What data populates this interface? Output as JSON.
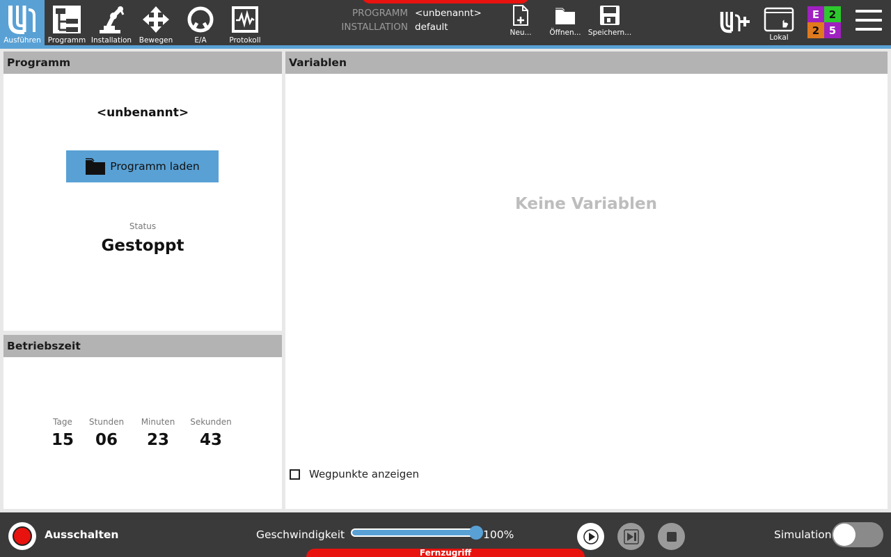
{
  "nav": {
    "tabs": [
      {
        "label": "Ausführen",
        "icon": "ur-logo-icon",
        "active": true
      },
      {
        "label": "Programm",
        "icon": "program-tree-icon"
      },
      {
        "label": "Installation",
        "icon": "robot-arm-icon"
      },
      {
        "label": "Bewegen",
        "icon": "move-arrows-icon"
      },
      {
        "label": "E/A",
        "icon": "io-icon"
      },
      {
        "label": "Protokoll",
        "icon": "log-graph-icon"
      }
    ]
  },
  "program_info": {
    "program_key": "PROGRAMM",
    "program_value": "<unbenannt>",
    "installation_key": "INSTALLATION",
    "installation_value": "default"
  },
  "file": {
    "new_label": "Neu...",
    "open_label": "Öffnen...",
    "save_label": "Speichern..."
  },
  "right": {
    "local_label": "Lokal",
    "status_grid": [
      {
        "text": "E",
        "color": "#a020c0"
      },
      {
        "text": "2",
        "color": "#2dc82d"
      },
      {
        "text": "2",
        "color": "#e07a1e"
      },
      {
        "text": "5",
        "color": "#a020c0"
      }
    ]
  },
  "program_panel": {
    "title": "Programm",
    "program_name": "<unbenannt>",
    "load_button": "Programm laden",
    "status_label": "Status",
    "status_value": "Gestoppt"
  },
  "runtime_panel": {
    "title": "Betriebszeit",
    "units": [
      {
        "label": "Tage",
        "value": "15"
      },
      {
        "label": "Stunden",
        "value": "06"
      },
      {
        "label": "Minuten",
        "value": "23"
      },
      {
        "label": "Sekunden",
        "value": "43"
      }
    ]
  },
  "variables_panel": {
    "title": "Variablen",
    "empty_text": "Keine Variablen",
    "waypoints_label": "Wegpunkte anzeigen",
    "waypoints_checked": false
  },
  "bottom": {
    "power_label": "Ausschalten",
    "speed_label": "Geschwindigkeit",
    "speed_value": "100%",
    "speed_fraction": 1.0,
    "simulation_label": "Simulation",
    "simulation_on": false,
    "remote_label": "Fernzugriff"
  },
  "colors": {
    "accent": "#59a1d5",
    "topbar": "#3a3a3a",
    "alert_red": "#e8130e"
  }
}
